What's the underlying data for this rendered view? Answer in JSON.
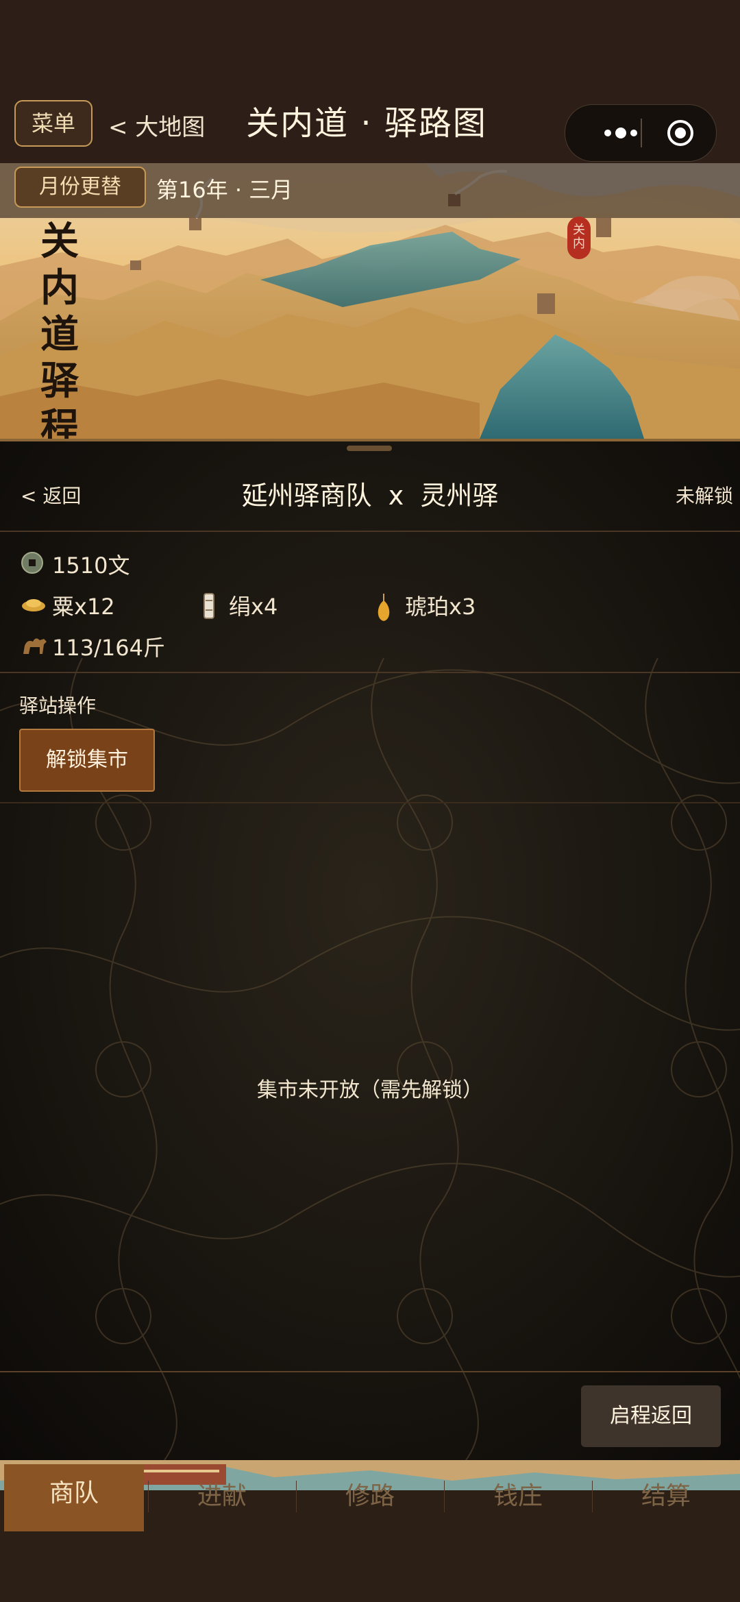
{
  "header": {
    "menu_label": "菜单",
    "back_map_label": "< 大地图",
    "title": "关内道 · 驿路图"
  },
  "calendar": {
    "button_label": "月份更替",
    "date_text": "第16年 · 三月"
  },
  "banner": {
    "vertical_title": "关内道驿程",
    "seal_text": "关内"
  },
  "route": {
    "back_label": "< 返回",
    "title": "延州驿商队  x  灵州驿",
    "lock_status": "未解锁"
  },
  "inventory": {
    "money": "1510文",
    "goods": [
      {
        "icon": "grain-icon",
        "label": "粟x12"
      },
      {
        "icon": "silk-scroll-icon",
        "label": "绢x4"
      },
      {
        "icon": "amber-icon",
        "label": "琥珀x3"
      }
    ],
    "cargo": "113/164斤"
  },
  "station": {
    "section_label": "驿站操作",
    "unlock_button": "解锁集市",
    "market_message": "集市未开放（需先解锁）"
  },
  "footer": {
    "return_button": "启程返回"
  },
  "tabs": [
    {
      "label": "商队",
      "active": true
    },
    {
      "label": "进献",
      "active": false
    },
    {
      "label": "修路",
      "active": false
    },
    {
      "label": "钱庄",
      "active": false
    },
    {
      "label": "结算",
      "active": false
    }
  ],
  "colors": {
    "background": "#2d1f17",
    "accent_border": "#c79a57",
    "unlock_button": "#7a4218",
    "active_tab": "#8b5424",
    "inactive_tab_text": "#7e6446"
  }
}
